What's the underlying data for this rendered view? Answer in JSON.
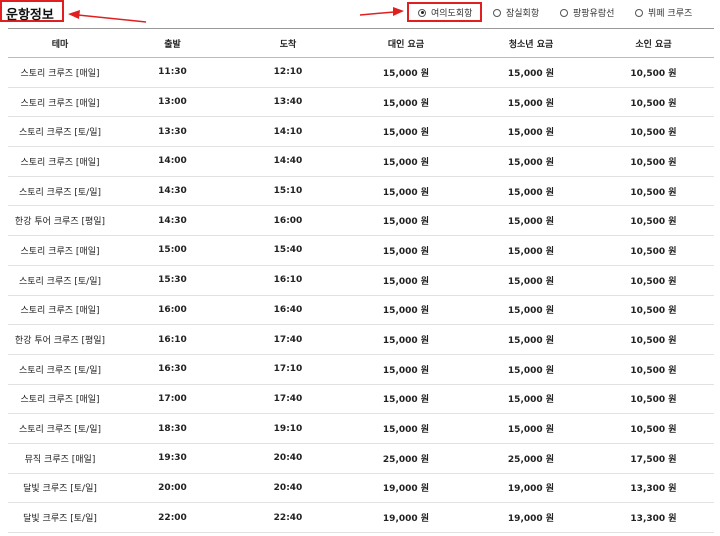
{
  "header": {
    "title": "운항정보"
  },
  "route_options": [
    {
      "label": "여의도회항",
      "selected": true
    },
    {
      "label": "잠실회항",
      "selected": false
    },
    {
      "label": "팡팡유람선",
      "selected": false
    },
    {
      "label": "뷔페 크루즈",
      "selected": false
    }
  ],
  "annotation_color": "#e02020",
  "table": {
    "headers": [
      "테마",
      "출발",
      "도착",
      "대인 요금",
      "청소년 요금",
      "소인 요금"
    ],
    "rows": [
      [
        "스토리 크루즈 [매일]",
        "11:30",
        "12:10",
        "15,000 원",
        "15,000 원",
        "10,500 원"
      ],
      [
        "스토리 크루즈 [매일]",
        "13:00",
        "13:40",
        "15,000 원",
        "15,000 원",
        "10,500 원"
      ],
      [
        "스토리 크루즈 [토/일]",
        "13:30",
        "14:10",
        "15,000 원",
        "15,000 원",
        "10,500 원"
      ],
      [
        "스토리 크루즈 [매일]",
        "14:00",
        "14:40",
        "15,000 원",
        "15,000 원",
        "10,500 원"
      ],
      [
        "스토리 크루즈 [토/일]",
        "14:30",
        "15:10",
        "15,000 원",
        "15,000 원",
        "10,500 원"
      ],
      [
        "한강 투어 크루즈 [평일]",
        "14:30",
        "16:00",
        "15,000 원",
        "15,000 원",
        "10,500 원"
      ],
      [
        "스토리 크루즈 [매일]",
        "15:00",
        "15:40",
        "15,000 원",
        "15,000 원",
        "10,500 원"
      ],
      [
        "스토리 크루즈 [토/일]",
        "15:30",
        "16:10",
        "15,000 원",
        "15,000 원",
        "10,500 원"
      ],
      [
        "스토리 크루즈 [매일]",
        "16:00",
        "16:40",
        "15,000 원",
        "15,000 원",
        "10,500 원"
      ],
      [
        "한강 투어 크루즈 [평일]",
        "16:10",
        "17:40",
        "15,000 원",
        "15,000 원",
        "10,500 원"
      ],
      [
        "스토리 크루즈 [토/일]",
        "16:30",
        "17:10",
        "15,000 원",
        "15,000 원",
        "10,500 원"
      ],
      [
        "스토리 크루즈 [매일]",
        "17:00",
        "17:40",
        "15,000 원",
        "15,000 원",
        "10,500 원"
      ],
      [
        "스토리 크루즈 [토/일]",
        "18:30",
        "19:10",
        "15,000 원",
        "15,000 원",
        "10,500 원"
      ],
      [
        "뮤직 크루즈 [매일]",
        "19:30",
        "20:40",
        "25,000 원",
        "25,000 원",
        "17,500 원"
      ],
      [
        "달빛 크루즈 [토/일]",
        "20:00",
        "20:40",
        "19,000 원",
        "19,000 원",
        "13,300 원"
      ],
      [
        "달빛 크루즈 [토/일]",
        "22:00",
        "22:40",
        "19,000 원",
        "19,000 원",
        "13,300 원"
      ]
    ]
  }
}
